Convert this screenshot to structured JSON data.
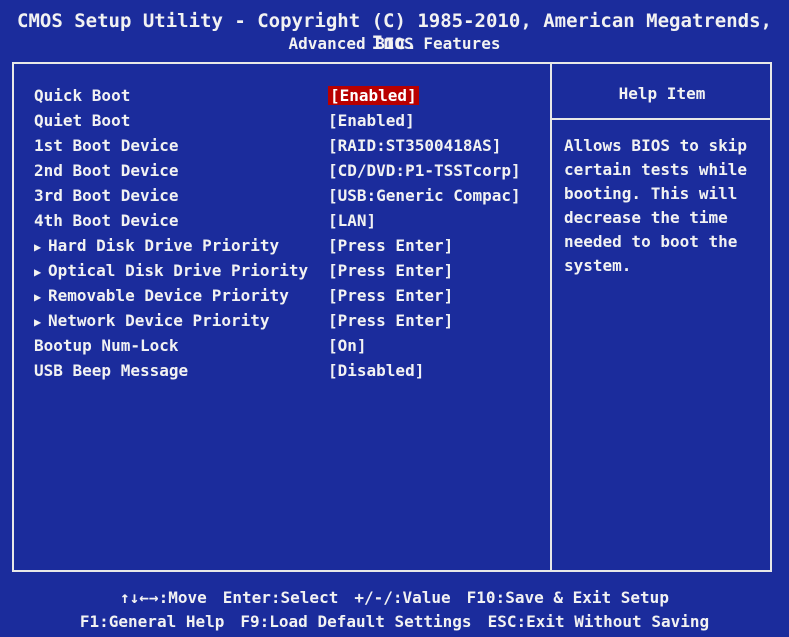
{
  "header": {
    "title": "CMOS Setup Utility - Copyright (C) 1985-2010, American Megatrends, Inc.",
    "page": "Advanced BIOS Features"
  },
  "settings": [
    {
      "label": "Quick Boot",
      "value": "[Enabled]",
      "submenu": false,
      "selected": true
    },
    {
      "label": "Quiet Boot",
      "value": "[Enabled]",
      "submenu": false,
      "selected": false
    },
    {
      "label": "1st Boot Device",
      "value": "[RAID:ST3500418AS]",
      "submenu": false,
      "selected": false
    },
    {
      "label": "2nd Boot Device",
      "value": "[CD/DVD:P1-TSSTcorp]",
      "submenu": false,
      "selected": false
    },
    {
      "label": "3rd Boot Device",
      "value": "[USB:Generic Compac]",
      "submenu": false,
      "selected": false
    },
    {
      "label": "4th Boot Device",
      "value": "[LAN]",
      "submenu": false,
      "selected": false
    },
    {
      "label": "Hard Disk Drive Priority",
      "value": "[Press Enter]",
      "submenu": true,
      "selected": false
    },
    {
      "label": "Optical Disk Drive Priority",
      "value": "[Press Enter]",
      "submenu": true,
      "selected": false
    },
    {
      "label": "Removable Device Priority",
      "value": "[Press Enter]",
      "submenu": true,
      "selected": false
    },
    {
      "label": "Network Device Priority",
      "value": "[Press Enter]",
      "submenu": true,
      "selected": false
    },
    {
      "label": "Bootup Num-Lock",
      "value": "[On]",
      "submenu": false,
      "selected": false
    },
    {
      "label": "USB Beep Message",
      "value": "[Disabled]",
      "submenu": false,
      "selected": false
    }
  ],
  "help": {
    "title": "Help Item",
    "text": "Allows BIOS to skip certain tests while booting. This will decrease the time needed to boot the system."
  },
  "footer": {
    "line1": [
      "↑↓←→:Move",
      "Enter:Select",
      "+/-/:Value",
      "F10:Save & Exit Setup"
    ],
    "line2": [
      "F1:General Help",
      "F9:Load Default Settings",
      "ESC:Exit Without Saving"
    ]
  },
  "colors": {
    "background": "#1b2c9c",
    "text": "#f2f2f2",
    "selection": "#b80000"
  }
}
